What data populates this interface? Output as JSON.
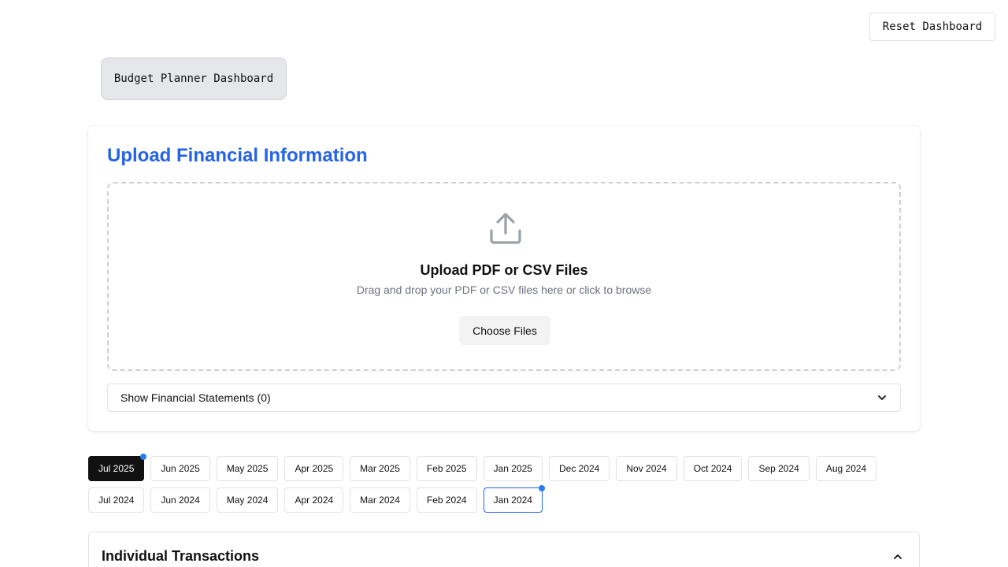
{
  "header": {
    "reset_label": "Reset Dashboard",
    "app_title": "Budget Planner Dashboard"
  },
  "upload": {
    "title": "Upload Financial Information",
    "icon": "upload-icon",
    "heading": "Upload PDF or CSV Files",
    "subtext": "Drag and drop your PDF or CSV files here or click to browse",
    "choose_label": "Choose Files",
    "statements_label": "Show Financial Statements (0)"
  },
  "months": {
    "row1": [
      "Jul 2025",
      "Jun 2025",
      "May 2025",
      "Apr 2025",
      "Mar 2025",
      "Feb 2025",
      "Jan 2025",
      "Dec 2024",
      "Nov 2024",
      "Oct 2024",
      "Sep 2024",
      "Aug 2024"
    ],
    "row2": [
      "Jul 2024",
      "Jun 2024",
      "May 2024",
      "Apr 2024",
      "Mar 2024",
      "Feb 2024",
      "Jan 2024"
    ],
    "selected": "Jul 2025",
    "outlined": "Jan 2024",
    "marked": [
      "Jul 2025",
      "Jan 2024"
    ]
  },
  "transactions": {
    "title": "Individual Transactions",
    "icon": "chevron-up-icon"
  },
  "colors": {
    "accent": "#2563eb",
    "dot": "#2b7bf0",
    "active_pill": "#111111"
  }
}
